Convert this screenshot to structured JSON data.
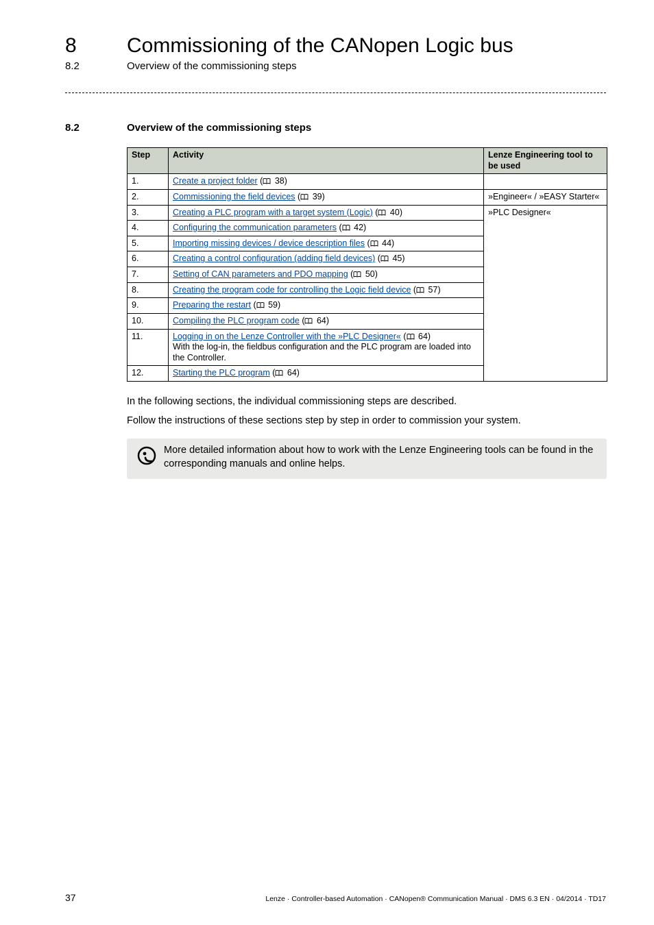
{
  "header": {
    "chapter_number": "8",
    "chapter_title": "Commissioning of the CANopen Logic bus",
    "sub_number": "8.2",
    "sub_title": "Overview of the commissioning steps"
  },
  "section": {
    "number": "8.2",
    "title": "Overview of the commissioning steps"
  },
  "table": {
    "headers": {
      "step": "Step",
      "activity": "Activity",
      "tool": "Lenze Engineering tool to be used"
    },
    "rows": [
      {
        "step": "1.",
        "link": "Create a project folder",
        "page": "38",
        "tool": ""
      },
      {
        "step": "2.",
        "link": "Commissioning the field devices",
        "page": "39",
        "tool": "»Engineer« / »EASY Starter«"
      },
      {
        "step": "3.",
        "link": "Creating a PLC program with a target system (Logic)",
        "page": "40",
        "tool": "»PLC Designer«"
      },
      {
        "step": "4.",
        "link": "Configuring the communication parameters",
        "page": "42",
        "tool": ""
      },
      {
        "step": "5.",
        "link": "Importing missing devices / device description files",
        "page": "44",
        "tool": ""
      },
      {
        "step": "6.",
        "link": "Creating a control configuration (adding field devices)",
        "page": "45",
        "tool": ""
      },
      {
        "step": "7.",
        "link": "Setting of CAN parameters and PDO mapping",
        "page": "50",
        "tool": ""
      },
      {
        "step": "8.",
        "link": "Creating the program code for controlling the Logic field device",
        "page": "57",
        "tool": ""
      },
      {
        "step": "9.",
        "link": "Preparing the restart",
        "page": "59",
        "tool": ""
      },
      {
        "step": "10.",
        "link": "Compiling the PLC program code",
        "page": "64",
        "tool": ""
      },
      {
        "step": "11.",
        "link": "Logging in on the Lenze Controller with the »PLC Designer«",
        "page": "64",
        "extra": "With the log-in, the fieldbus configuration and the PLC program are loaded into the Controller.",
        "tool": ""
      },
      {
        "step": "12.",
        "link": "Starting the PLC program",
        "page": "64",
        "tool": ""
      }
    ]
  },
  "body": {
    "line1": "In the following sections, the individual commissioning steps are described.",
    "line2": "Follow the instructions of these sections step by step in order to commission your system."
  },
  "tip": {
    "text": "More detailed information about how to work with the Lenze Engineering tools can be found in the corresponding manuals and online helps."
  },
  "footer": {
    "page": "37",
    "line": "Lenze · Controller-based Automation · CANopen® Communication Manual · DMS 6.3 EN · 04/2014 · TD17"
  }
}
